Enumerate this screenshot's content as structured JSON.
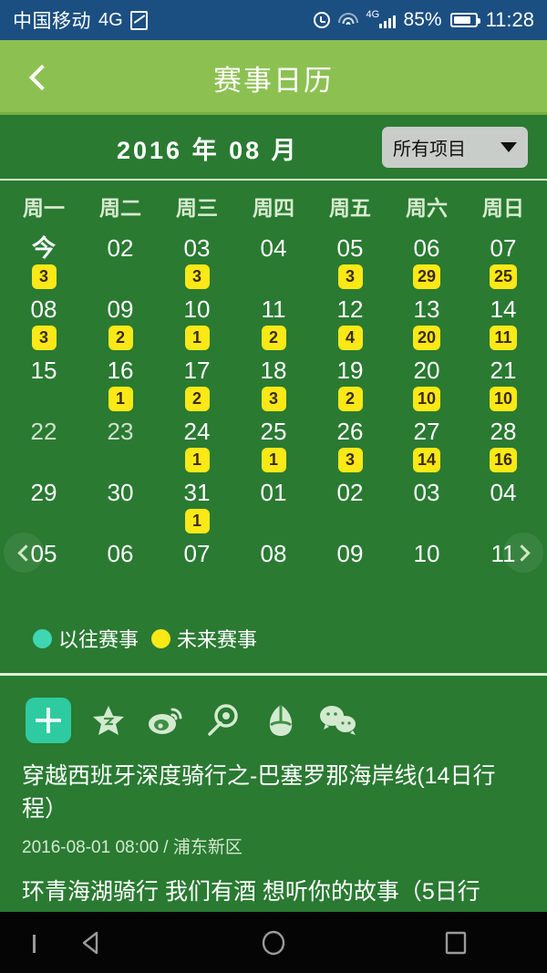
{
  "status_bar": {
    "carrier": "中国移动",
    "network": "4G",
    "battery_percent": "85%",
    "time": "11:28",
    "icons": [
      "sim-card-icon",
      "alarm-icon",
      "wifi-icon",
      "signal-icon",
      "battery-icon"
    ]
  },
  "header": {
    "title": "赛事日历",
    "back_icon": "chevron-left-icon",
    "bg_color": "#8cc152"
  },
  "month_bar": {
    "year": "2016",
    "year_unit": "年",
    "month": "08",
    "month_unit": "月",
    "label": "2016 年  08 月",
    "project_filter": {
      "selected": "所有项目",
      "caret_icon": "chevron-down-icon"
    }
  },
  "calendar": {
    "weekdays": [
      "周一",
      "周二",
      "周三",
      "周四",
      "周五",
      "周六",
      "周日"
    ],
    "prev_icon": "chevron-left-icon",
    "next_icon": "chevron-right-icon",
    "rows": [
      [
        {
          "day": "今",
          "badge": "3",
          "today": true,
          "dim": false
        },
        {
          "day": "02",
          "badge": "",
          "today": false,
          "dim": false
        },
        {
          "day": "03",
          "badge": "3",
          "today": false,
          "dim": false
        },
        {
          "day": "04",
          "badge": "",
          "today": false,
          "dim": false
        },
        {
          "day": "05",
          "badge": "3",
          "today": false,
          "dim": false
        },
        {
          "day": "06",
          "badge": "29",
          "today": false,
          "dim": false
        },
        {
          "day": "07",
          "badge": "25",
          "today": false,
          "dim": false
        }
      ],
      [
        {
          "day": "08",
          "badge": "3",
          "today": false,
          "dim": false
        },
        {
          "day": "09",
          "badge": "2",
          "today": false,
          "dim": false
        },
        {
          "day": "10",
          "badge": "1",
          "today": false,
          "dim": false
        },
        {
          "day": "11",
          "badge": "2",
          "today": false,
          "dim": false
        },
        {
          "day": "12",
          "badge": "4",
          "today": false,
          "dim": false
        },
        {
          "day": "13",
          "badge": "20",
          "today": false,
          "dim": false
        },
        {
          "day": "14",
          "badge": "11",
          "today": false,
          "dim": false
        }
      ],
      [
        {
          "day": "15",
          "badge": "",
          "today": false,
          "dim": false
        },
        {
          "day": "16",
          "badge": "1",
          "today": false,
          "dim": false
        },
        {
          "day": "17",
          "badge": "2",
          "today": false,
          "dim": false
        },
        {
          "day": "18",
          "badge": "3",
          "today": false,
          "dim": false
        },
        {
          "day": "19",
          "badge": "2",
          "today": false,
          "dim": false
        },
        {
          "day": "20",
          "badge": "10",
          "today": false,
          "dim": false
        },
        {
          "day": "21",
          "badge": "10",
          "today": false,
          "dim": false
        }
      ],
      [
        {
          "day": "22",
          "badge": "",
          "today": false,
          "dim": true
        },
        {
          "day": "23",
          "badge": "",
          "today": false,
          "dim": true
        },
        {
          "day": "24",
          "badge": "1",
          "today": false,
          "dim": false
        },
        {
          "day": "25",
          "badge": "1",
          "today": false,
          "dim": false
        },
        {
          "day": "26",
          "badge": "3",
          "today": false,
          "dim": false
        },
        {
          "day": "27",
          "badge": "14",
          "today": false,
          "dim": false
        },
        {
          "day": "28",
          "badge": "16",
          "today": false,
          "dim": false
        }
      ],
      [
        {
          "day": "29",
          "badge": "",
          "today": false,
          "dim": false
        },
        {
          "day": "30",
          "badge": "",
          "today": false,
          "dim": false
        },
        {
          "day": "31",
          "badge": "1",
          "today": false,
          "dim": false
        },
        {
          "day": "01",
          "badge": "",
          "today": false,
          "dim": false
        },
        {
          "day": "02",
          "badge": "",
          "today": false,
          "dim": false
        },
        {
          "day": "03",
          "badge": "",
          "today": false,
          "dim": false
        },
        {
          "day": "04",
          "badge": "",
          "today": false,
          "dim": false
        }
      ],
      [
        {
          "day": "05",
          "badge": "",
          "today": false,
          "dim": false
        },
        {
          "day": "06",
          "badge": "",
          "today": false,
          "dim": false
        },
        {
          "day": "07",
          "badge": "",
          "today": false,
          "dim": false
        },
        {
          "day": "08",
          "badge": "",
          "today": false,
          "dim": false
        },
        {
          "day": "09",
          "badge": "",
          "today": false,
          "dim": false
        },
        {
          "day": "10",
          "badge": "",
          "today": false,
          "dim": false
        },
        {
          "day": "11",
          "badge": "",
          "today": false,
          "dim": false
        }
      ]
    ]
  },
  "legend": {
    "past": {
      "label": "以往赛事",
      "color": "#3fd6b2"
    },
    "future": {
      "label": "未来赛事",
      "color": "#fbe817"
    }
  },
  "share_bar": {
    "add_icon": "plus-icon",
    "items": [
      "star-icon",
      "weibo-icon",
      "qzone-icon",
      "alipay-icon",
      "wechat-icon"
    ]
  },
  "events": [
    {
      "title": "穿越西班牙深度骑行之-巴塞罗那海岸线(14日行程）",
      "meta": "2016-08-01 08:00 / 浦东新区"
    },
    {
      "title": "环青海湖骑行 我们有酒 想听你的故事（5日行",
      "meta": ""
    }
  ],
  "nav_bar": {
    "hide_icon": "chevron-down-icon",
    "back_icon": "triangle-back-icon",
    "home_icon": "circle-home-icon",
    "recents_icon": "square-recents-icon"
  }
}
